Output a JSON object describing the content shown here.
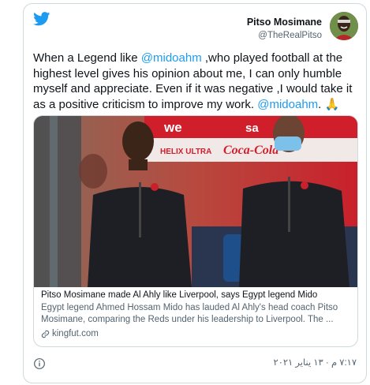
{
  "author": {
    "display_name": "Pitso Mosimane",
    "handle": "@TheRealPitso"
  },
  "tweet": {
    "text_1": "When a Legend like ",
    "mention_1": "@midoahm",
    "text_2": " ,who played football at the highest level gives his opinion about me, I can only humble myself and appreciate. Even if it was negative ,I would take it as a positive criticism to improve my work. ",
    "mention_2": "@midoahm",
    "text_3": ". ",
    "emoji": "🙏"
  },
  "card": {
    "title": "Pitso Mosimane made Al Ahly like Liverpool, says Egypt legend Mido",
    "description": "Egypt legend Ahmed Hossam Mido has lauded Al Ahly's head coach Pitso Mosimane, comparing the Reds under his leadership to Liverpool. The ...",
    "domain": "kingfut.com",
    "image_texts": {
      "sponsor_we": "we",
      "sponsor_sa": "sa",
      "sponsor_helix": "HELIX ULTRA",
      "sponsor_cocacola": "Coca-Cola"
    }
  },
  "footer": {
    "timestamp": "٧:١٧ م · ١٣ يناير ٢٠٢١"
  },
  "colors": {
    "link": "#1d9bf0",
    "secondary_text": "#536471",
    "border": "#cfd9de",
    "jacket": "#1e1f25",
    "stadium_red": "#c9202b"
  },
  "icons": [
    "twitter-logo-icon",
    "link-icon",
    "info-icon"
  ]
}
